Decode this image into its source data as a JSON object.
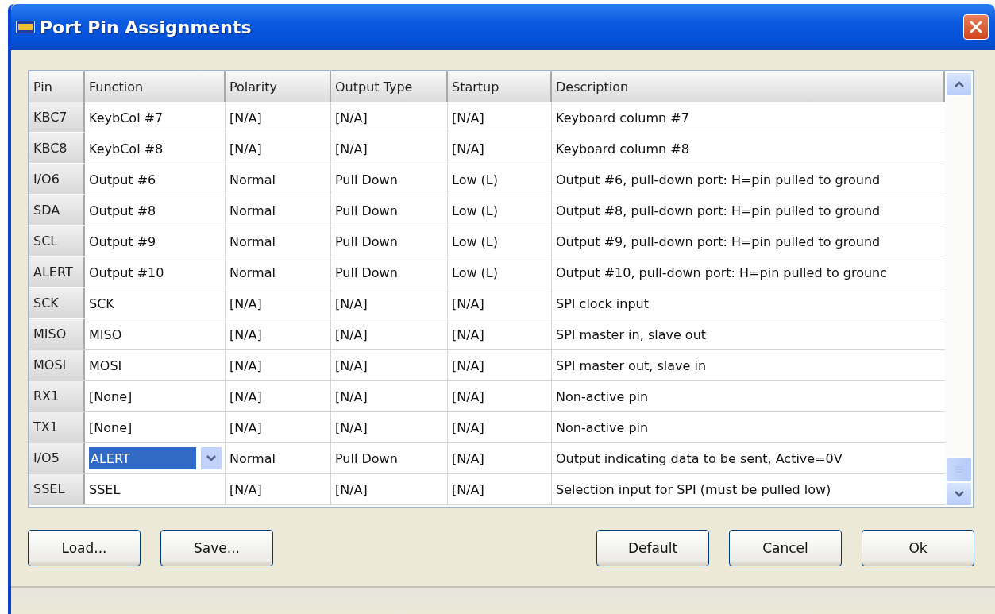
{
  "window": {
    "title": "Port Pin Assignments"
  },
  "table": {
    "columns": [
      "Pin",
      "Function",
      "Polarity",
      "Output Type",
      "Startup",
      "Description"
    ],
    "rows": [
      {
        "pin": "KBC7",
        "function": "KeybCol #7",
        "polarity": "[N/A]",
        "output_type": "[N/A]",
        "startup": "[N/A]",
        "description": "Keyboard column #7",
        "editing": false
      },
      {
        "pin": "KBC8",
        "function": "KeybCol #8",
        "polarity": "[N/A]",
        "output_type": "[N/A]",
        "startup": "[N/A]",
        "description": "Keyboard column #8",
        "editing": false
      },
      {
        "pin": "I/O6",
        "function": "Output #6",
        "polarity": "Normal",
        "output_type": "Pull Down",
        "startup": "Low (L)",
        "description": "Output #6, pull-down port: H=pin pulled to ground",
        "editing": false
      },
      {
        "pin": "SDA",
        "function": "Output #8",
        "polarity": "Normal",
        "output_type": "Pull Down",
        "startup": "Low (L)",
        "description": "Output #8, pull-down port: H=pin pulled to ground",
        "editing": false
      },
      {
        "pin": "SCL",
        "function": "Output #9",
        "polarity": "Normal",
        "output_type": "Pull Down",
        "startup": "Low (L)",
        "description": "Output #9, pull-down port: H=pin pulled to ground",
        "editing": false
      },
      {
        "pin": "ALERT",
        "function": "Output #10",
        "polarity": "Normal",
        "output_type": "Pull Down",
        "startup": "Low (L)",
        "description": "Output #10, pull-down port: H=pin pulled to grounc",
        "editing": false
      },
      {
        "pin": "SCK",
        "function": "SCK",
        "polarity": "[N/A]",
        "output_type": "[N/A]",
        "startup": "[N/A]",
        "description": "SPI clock input",
        "editing": false
      },
      {
        "pin": "MISO",
        "function": "MISO",
        "polarity": "[N/A]",
        "output_type": "[N/A]",
        "startup": "[N/A]",
        "description": "SPI master in, slave out",
        "editing": false
      },
      {
        "pin": "MOSI",
        "function": "MOSI",
        "polarity": "[N/A]",
        "output_type": "[N/A]",
        "startup": "[N/A]",
        "description": "SPI master out, slave in",
        "editing": false
      },
      {
        "pin": "RX1",
        "function": "[None]",
        "polarity": "[N/A]",
        "output_type": "[N/A]",
        "startup": "[N/A]",
        "description": "Non-active pin",
        "editing": false
      },
      {
        "pin": "TX1",
        "function": "[None]",
        "polarity": "[N/A]",
        "output_type": "[N/A]",
        "startup": "[N/A]",
        "description": "Non-active pin",
        "editing": false
      },
      {
        "pin": "I/O5",
        "function": "ALERT",
        "polarity": "Normal",
        "output_type": "Pull Down",
        "startup": "[N/A]",
        "description": "Output indicating data to be sent, Active=0V",
        "editing": true
      },
      {
        "pin": "SSEL",
        "function": "SSEL",
        "polarity": "[N/A]",
        "output_type": "[N/A]",
        "startup": "[N/A]",
        "description": "Selection input for SPI (must be pulled low)",
        "editing": false
      }
    ]
  },
  "buttons_left": [
    "Load...",
    "Save..."
  ],
  "buttons_right": [
    "Default",
    "Cancel",
    "Ok"
  ]
}
